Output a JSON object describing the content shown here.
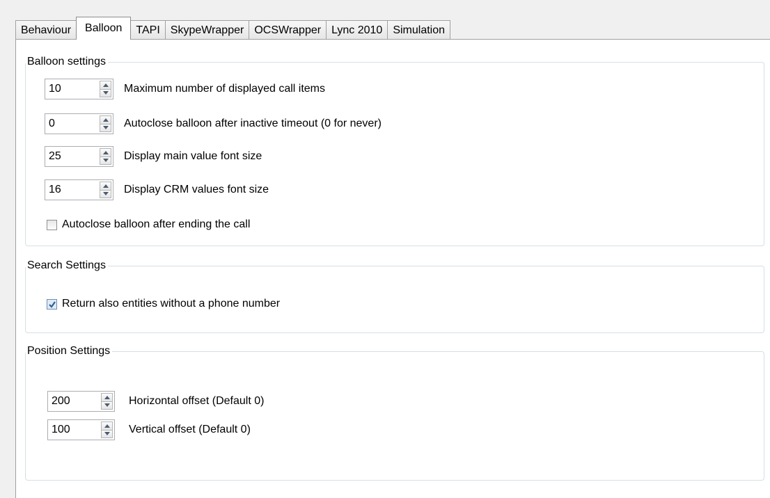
{
  "tabs": [
    "Behaviour",
    "Balloon",
    "TAPI",
    "SkypeWrapper",
    "OCSWrapper",
    "Lync 2010",
    "Simulation"
  ],
  "active_tab": "Balloon",
  "balloon_settings": {
    "title": "Balloon settings",
    "fields": [
      {
        "value": "10",
        "label": "Maximum number of displayed call items"
      },
      {
        "value": "0",
        "label": "Autoclose balloon after inactive timeout (0 for never)"
      },
      {
        "value": "25",
        "label": "Display main value font size"
      },
      {
        "value": "16",
        "label": "Display CRM values font size"
      }
    ],
    "autoclose_checkbox": {
      "label": "Autoclose balloon after ending the call",
      "checked": false
    }
  },
  "search_settings": {
    "title": "Search Settings",
    "return_checkbox": {
      "label": "Return also entities without a phone number",
      "checked": true
    }
  },
  "position_settings": {
    "title": "Position Settings",
    "fields": [
      {
        "value": "200",
        "label": "Horizontal offset (Default 0)"
      },
      {
        "value": "100",
        "label": "Vertical offset (Default 0)"
      }
    ]
  },
  "colors": {
    "group_border": "#d5dfe5",
    "check_accent": "#2f5f9a"
  }
}
